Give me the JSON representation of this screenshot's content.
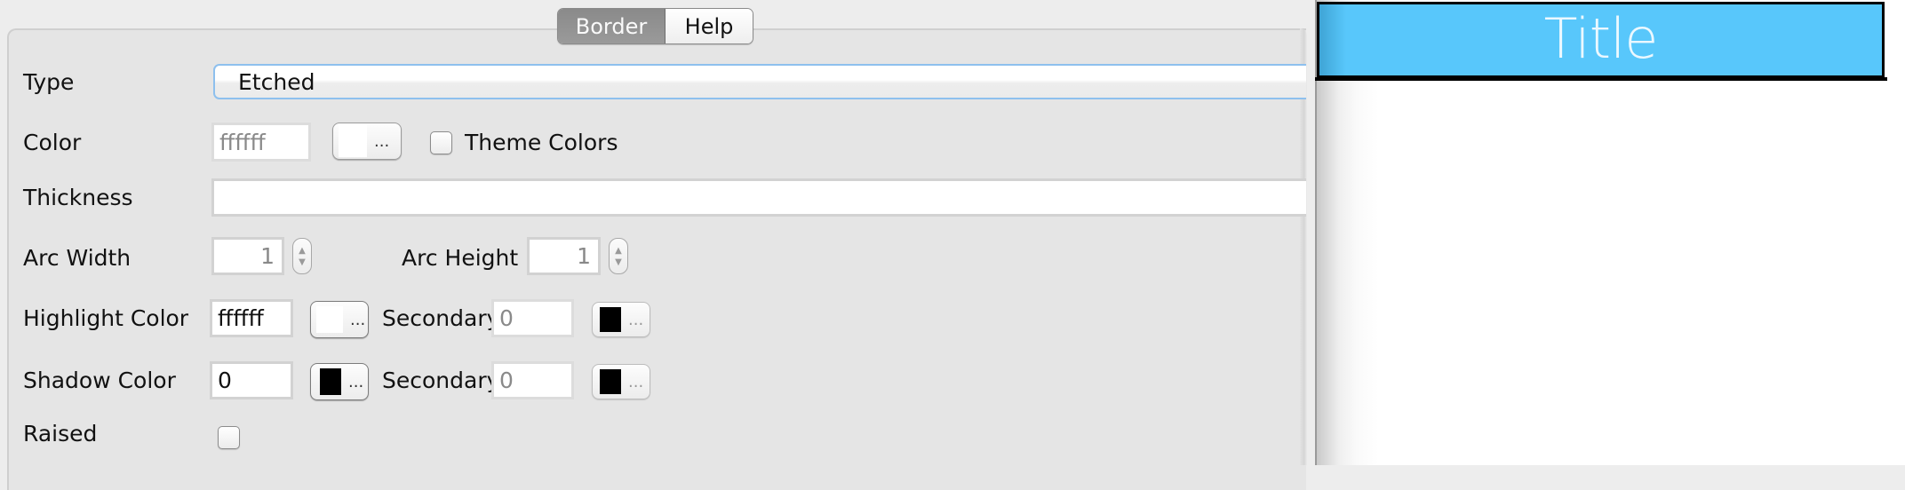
{
  "tabs": [
    {
      "label": "Border",
      "selected": true
    },
    {
      "label": "Help",
      "selected": false
    }
  ],
  "form": {
    "type": {
      "label": "Type",
      "value": "Etched"
    },
    "color": {
      "label": "Color",
      "value": "ffffff",
      "swatch": "#ffffff",
      "button_label": "...",
      "theme_colors_label": "Theme Colors",
      "theme_colors_checked": false
    },
    "thickness": {
      "label": "Thickness",
      "value": ""
    },
    "arc_width": {
      "label": "Arc Width",
      "value": "1"
    },
    "arc_height": {
      "label": "Arc Height",
      "value": "1"
    },
    "highlight_color": {
      "label": "Highlight Color",
      "value": "ffffff",
      "swatch": "#ffffff",
      "button_label": "...",
      "secondary_label": "Secondary",
      "secondary_value": "0",
      "secondary_swatch": "#000000",
      "secondary_button_label": "..."
    },
    "shadow_color": {
      "label": "Shadow Color",
      "value": "0",
      "swatch": "#000000",
      "button_label": "...",
      "secondary_label": "Secondary",
      "secondary_value": "0",
      "secondary_swatch": "#000000",
      "secondary_button_label": "..."
    },
    "raised": {
      "label": "Raised",
      "checked": false
    }
  },
  "preview": {
    "title": "Title",
    "background_color": "#58c7fb",
    "border_color": "#000000"
  },
  "icons": {
    "stepper_up": "▲",
    "stepper_down": "▼"
  }
}
